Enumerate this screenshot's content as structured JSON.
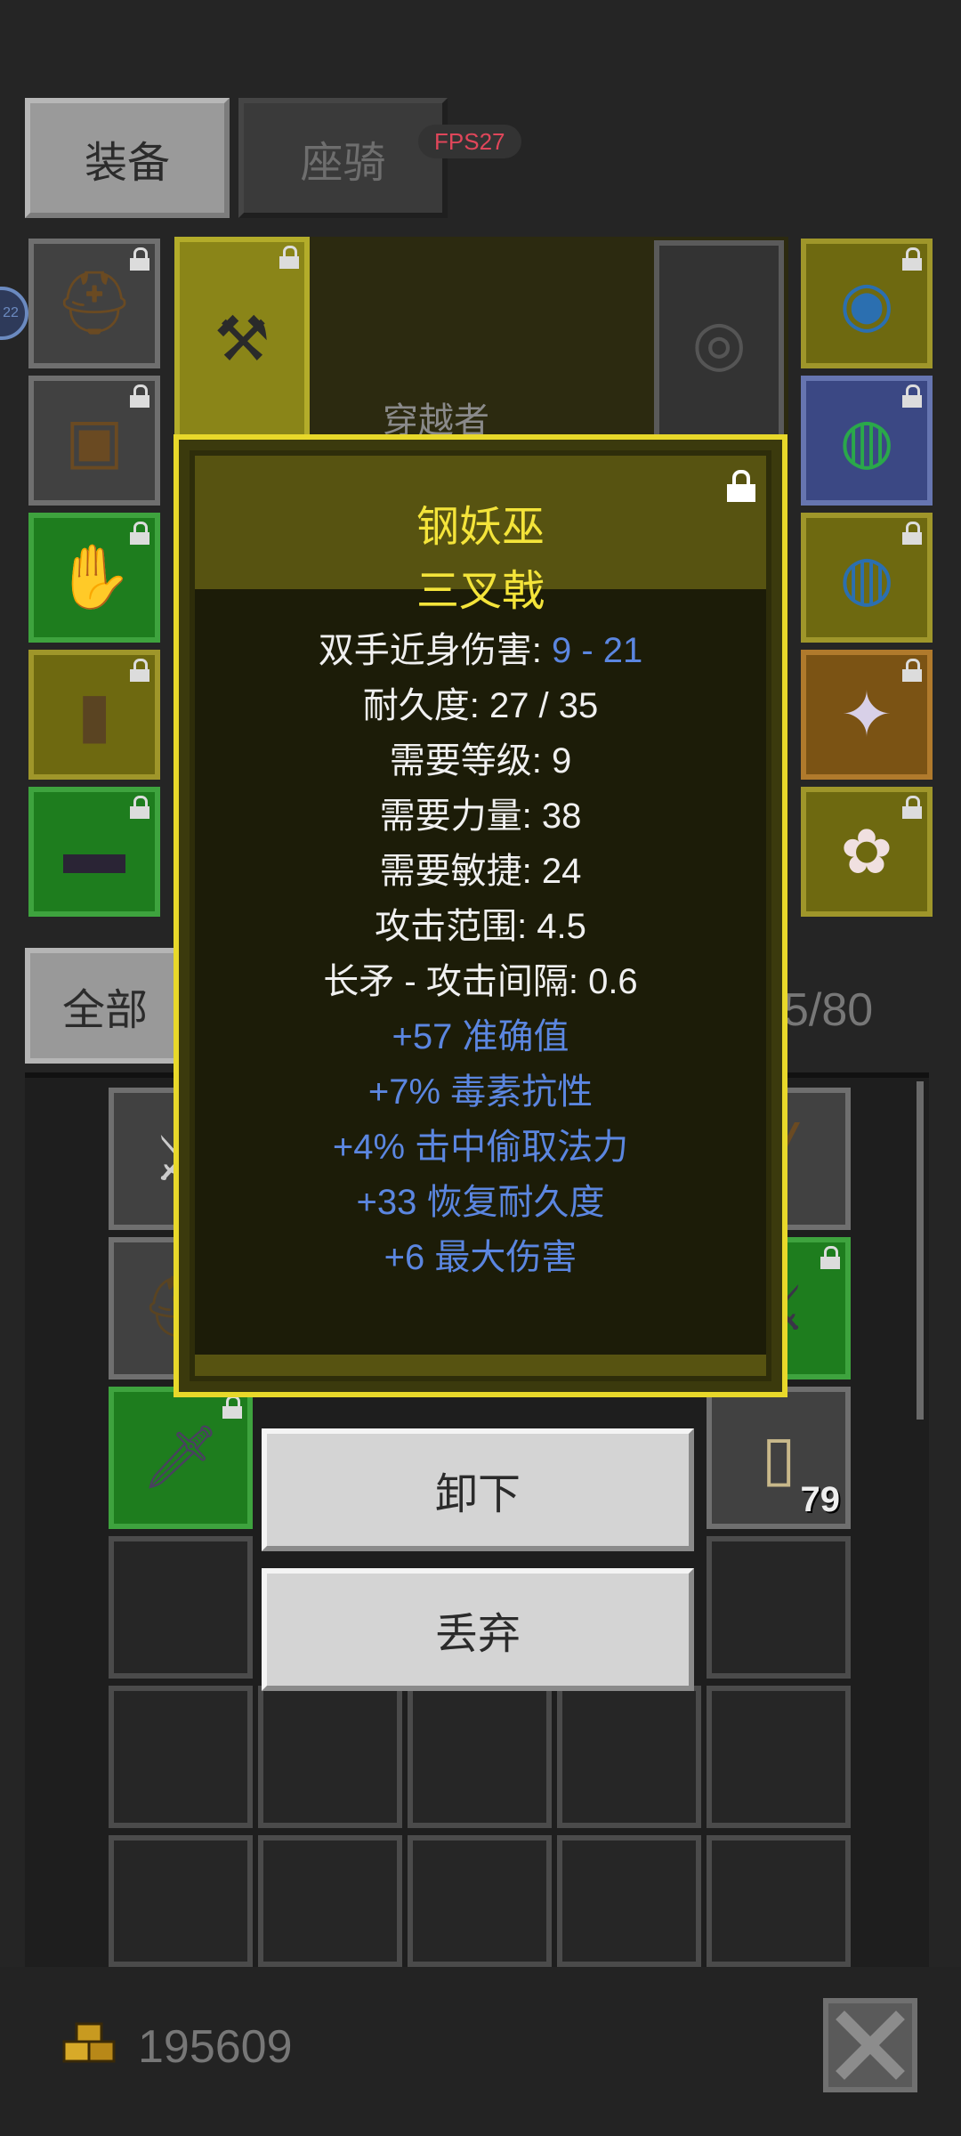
{
  "tabs": {
    "equipment": "装备",
    "mount": "座骑"
  },
  "fps_label": "FPS27",
  "side_badge": "22",
  "character_name": "穿越者",
  "filter_label": "全部",
  "inventory_capacity": "5/80",
  "stack_count": "79",
  "tooltip": {
    "name_line1": "钢妖巫",
    "name_line2": "三叉戟",
    "stats": [
      {
        "label": "双手近身伤害: ",
        "value": "9 - 21"
      },
      {
        "label": "耐久度: 27 / 35",
        "value": ""
      },
      {
        "label": "需要等级: 9",
        "value": ""
      },
      {
        "label": "需要力量: 38",
        "value": ""
      },
      {
        "label": "需要敏捷: 24",
        "value": ""
      },
      {
        "label": "攻击范围: 4.5",
        "value": ""
      },
      {
        "label": "长矛 - 攻击间隔: 0.6",
        "value": ""
      }
    ],
    "affixes": [
      "+57 准确值",
      "+7% 毒素抗性",
      "+4% 击中偷取法力",
      "+33 恢复耐久度",
      "+6 最大伤害"
    ]
  },
  "actions": {
    "unequip": "卸下",
    "discard": "丢弃"
  },
  "gold": "195609",
  "colors": {
    "title_yellow": "#f4e43a",
    "affix_blue": "#5b86e0",
    "tooltip_border": "#e8d82a"
  },
  "icons": [
    "helmet-icon",
    "chest-armor-icon",
    "gloves-icon",
    "boots-icon",
    "belt-icon",
    "trident-icon",
    "mount-icon",
    "amulet-icon",
    "ring-icon",
    "scroll-icon",
    "gold-coins-icon",
    "close-icon",
    "lock-icon"
  ]
}
